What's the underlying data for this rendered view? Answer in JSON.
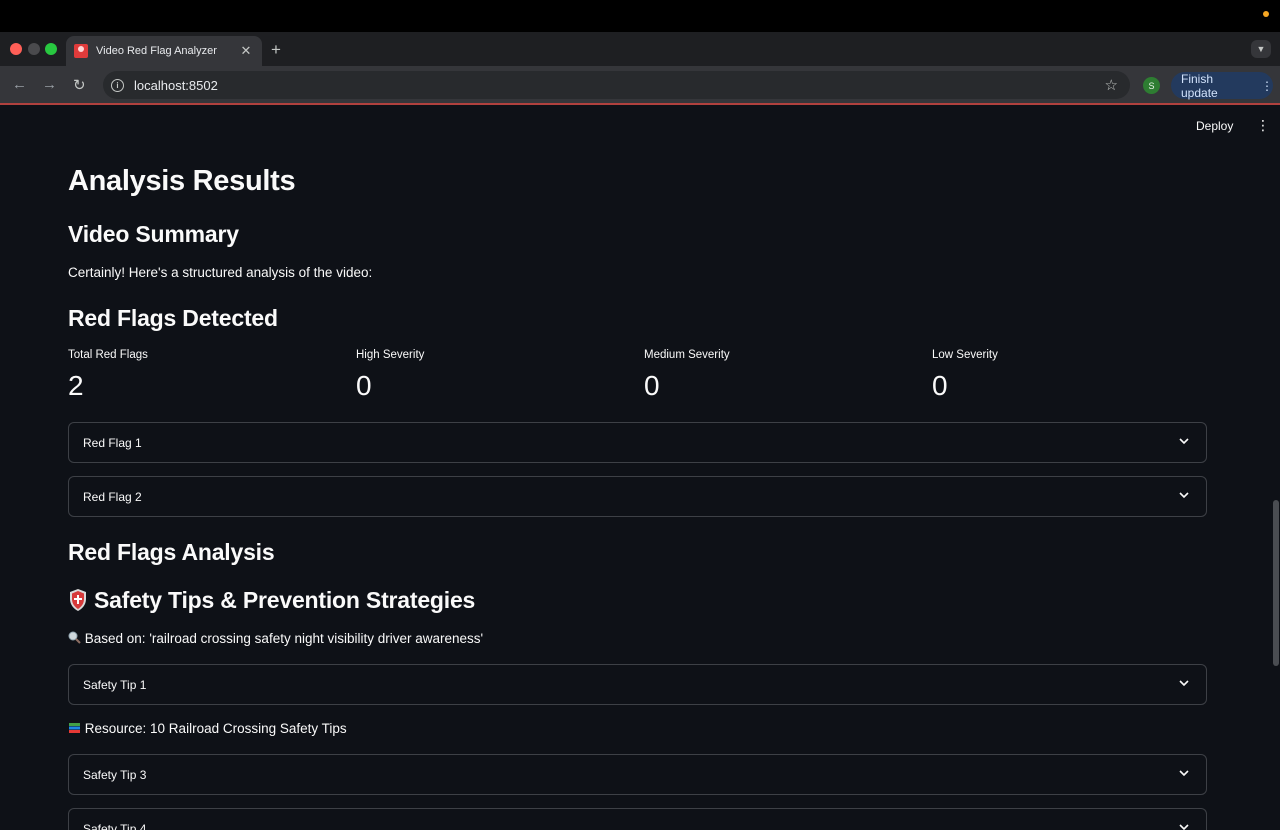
{
  "browser": {
    "tab_title": "Video Red Flag Analyzer",
    "url": "localhost:8502",
    "profile_initial": "S",
    "finish_update_label": "Finish update"
  },
  "app_header": {
    "deploy_label": "Deploy"
  },
  "page": {
    "title": "Analysis Results",
    "video_summary": {
      "heading": "Video Summary",
      "text": "Certainly! Here's a structured analysis of the video:"
    },
    "red_flags": {
      "heading": "Red Flags Detected",
      "metrics": [
        {
          "label": "Total Red Flags",
          "value": "2"
        },
        {
          "label": "High Severity",
          "value": "0"
        },
        {
          "label": "Medium Severity",
          "value": "0"
        },
        {
          "label": "Low Severity",
          "value": "0"
        }
      ],
      "expanders": [
        "Red Flag 1",
        "Red Flag 2"
      ]
    },
    "analysis_heading": "Red Flags Analysis",
    "safety": {
      "heading": "Safety Tips & Prevention Strategies",
      "based_on": "Based on: 'railroad crossing safety night visibility driver awareness'",
      "tip1": "Safety Tip 1",
      "resource": "Resource: 10 Railroad Crossing Safety Tips",
      "tip3": "Safety Tip 3",
      "tip4": "Safety Tip 4"
    }
  },
  "icons": {
    "safety_heading": "shield-icon",
    "based_on": "magnifier-icon",
    "resource": "books-icon"
  },
  "colors": {
    "app_background": "#0e1117",
    "text": "#fafafa",
    "expander_border": "#3d4046",
    "accent_bar": "#b0413e"
  }
}
